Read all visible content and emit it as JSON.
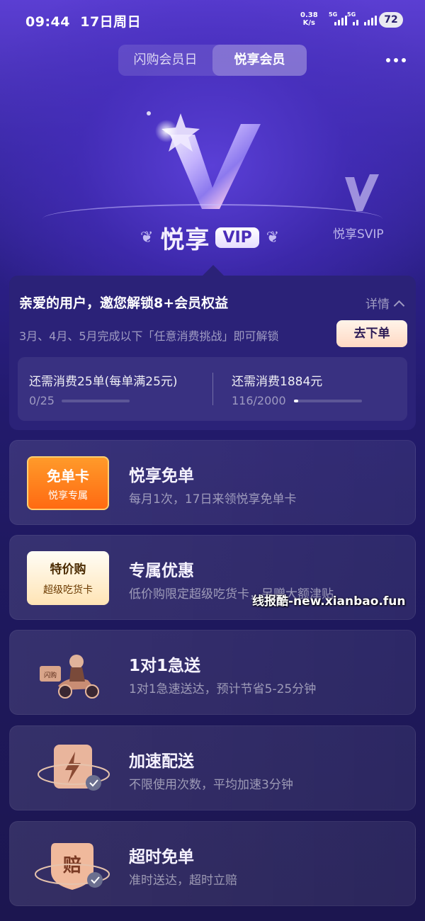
{
  "status_bar": {
    "time": "09:44",
    "date": "17日周日",
    "net_speed_value": "0.38",
    "net_speed_unit": "K/s",
    "sim1_label": "5G",
    "sim2_label": "5G",
    "battery": "72"
  },
  "tabs": [
    {
      "label": "闪购会员日",
      "active": false
    },
    {
      "label": "悦享会员",
      "active": true
    }
  ],
  "hero": {
    "title": "悦享",
    "badge": "VIP",
    "secondary_tier": "悦享SVIP"
  },
  "unlock": {
    "title": "亲爱的用户，邀您解锁8+会员权益",
    "detail_label": "详情",
    "subtitle": "3月、4月、5月完成以下「任意消费挑战」即可解锁",
    "action_label": "去下单",
    "progress": [
      {
        "label": "还需消费25单(每单满25元)",
        "count": "0/25",
        "fraction": 0.0
      },
      {
        "label": "还需消费1884元",
        "count": "116/2000",
        "fraction": 0.058
      }
    ]
  },
  "benefits": [
    {
      "card_line1": "免单卡",
      "card_line2": "悦享专属",
      "title": "悦享免单",
      "desc": "每月1次，17日来领悦享免单卡"
    },
    {
      "card_line1": "特价购",
      "card_line2": "超级吃货卡",
      "title": "专属优惠",
      "desc": "低价购限定超级吃货卡，另赠大额津贴"
    },
    {
      "icon_text": "闪购",
      "title": "1对1急送",
      "desc": "1对1急速送达，预计节省5-25分钟"
    },
    {
      "title": "加速配送",
      "desc": "不限使用次数，平均加速3分钟"
    },
    {
      "icon_text": "赔",
      "title": "超时免单",
      "desc": "准时送达，超时立赔"
    }
  ],
  "watermark": "线报酷-new.xianbao.fun",
  "colors": {
    "background_top": "#5b3ed2",
    "background_bottom": "#1c1650",
    "unlock_card": "#2b2278",
    "order_button": "#ffd9c4",
    "free_card": "#ff7a18"
  }
}
